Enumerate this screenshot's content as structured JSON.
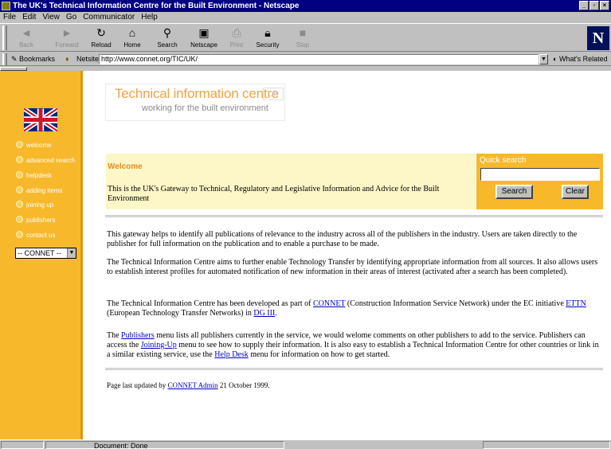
{
  "window": {
    "title": "The UK's Technical Information Centre for the Built Environment - Netscape"
  },
  "menu": [
    "File",
    "Edit",
    "View",
    "Go",
    "Communicator",
    "Help"
  ],
  "toolbar": {
    "back": "Back",
    "forward": "Forward",
    "reload": "Reload",
    "home": "Home",
    "search": "Search",
    "netscape": "Netscape",
    "print": "Print",
    "security": "Security",
    "stop": "Stop"
  },
  "location": {
    "bookmarks": "Bookmarks",
    "label": "Netsite:",
    "url": "http://www.connet.org/TIC/UK/",
    "whats_related": "What's Related"
  },
  "header": {
    "title": "Technical information centre",
    "country": "UK",
    "subtitle": "working for the built environment"
  },
  "sidebar": {
    "items": [
      {
        "label": "welcome"
      },
      {
        "label": "advanced search"
      },
      {
        "label": "helpdesk"
      },
      {
        "label": "adding items"
      },
      {
        "label": "joining up"
      },
      {
        "label": "publishers"
      },
      {
        "label": "contact us"
      }
    ],
    "select_value": "-- CONNET --"
  },
  "welcome": {
    "heading": "Welcome",
    "text": "This is the UK's Gateway to Technical, Regulatory and Legislative Information and Advice for the Built Environment"
  },
  "quick_search": {
    "label": "Quick search",
    "input_value": "",
    "search_button": "Search",
    "clear_button": "Clear"
  },
  "body": {
    "p1": "This gateway helps to identify all publications of relevance to the industry across all of the publishers in the industry. Users are taken directly to the publisher for full information on the publication and to enable a purchase to be made.",
    "p2": "The Technical Information Centre aims to further enable Technology Transfer by identifying appropriate information from all sources. It also allows users to establish interest profiles for automated notification of new information in their areas of interest (activated after a search has been completed).",
    "p3": {
      "t1": "The Technical Information Centre has been developed as part of ",
      "link1": "CONNET",
      "t2": " (Construction Information Service Network) under the EC initiative ",
      "link2": "ETTN",
      "t3": " (European Technology Transfer Networks) in ",
      "link3": "DG III",
      "t4": "."
    },
    "p4": {
      "t1": "The ",
      "link1": "Publishers",
      "t2": " menu lists all publishers currently in the service, we would welome comments on other publishers to add to the service. Publishers can access the ",
      "link2": "Joining-Up",
      "t3": " menu to see how to supply their information. It is also easy to establish a Technical Information Centre for other countries or link in a similar existing service, use the ",
      "link3": "Help Desk",
      "t4": " menu for information on how to get started."
    },
    "footer": {
      "t1": "Page last updated by ",
      "link": "CONNET Admin",
      "t2": " 21 October 1999."
    }
  },
  "status": {
    "text": "Document: Done"
  },
  "colors": {
    "sidebar": "#f7b92b",
    "welcome_bg": "#fdf6c7",
    "accent": "#ec8c1f",
    "link": "#0000cc"
  }
}
